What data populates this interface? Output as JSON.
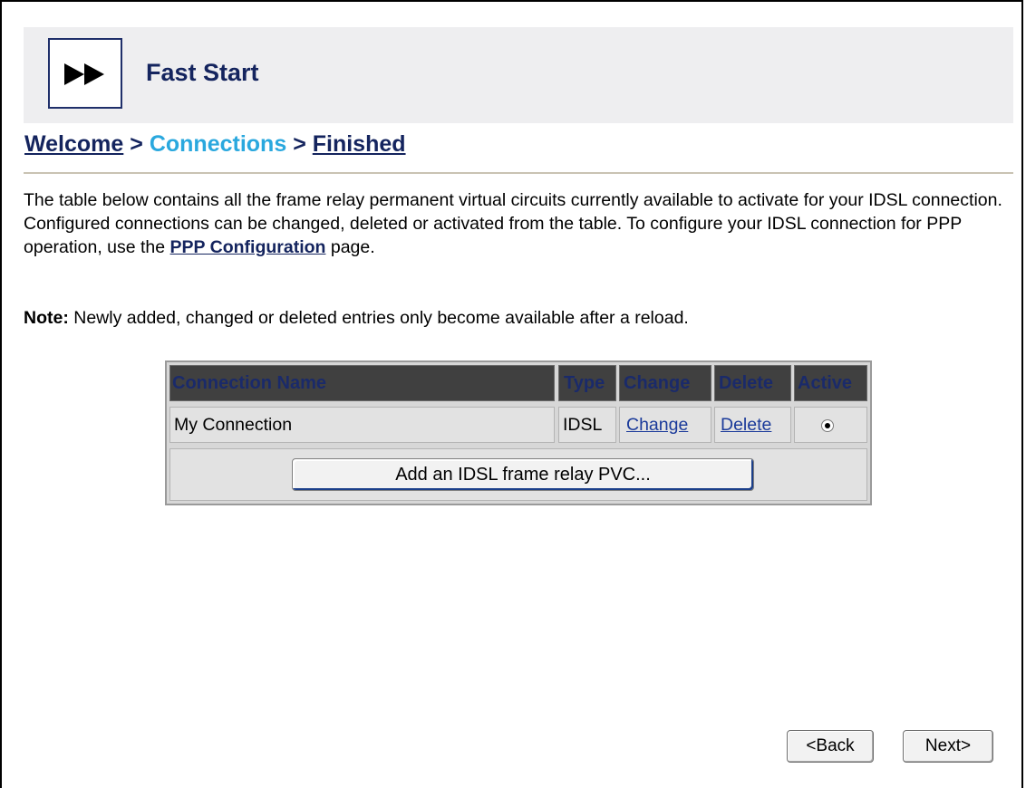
{
  "header": {
    "title": "Fast Start",
    "logo_icon": "fast-forward-icon"
  },
  "breadcrumb": {
    "items": [
      "Welcome",
      "Connections",
      "Finished"
    ],
    "separator": ">"
  },
  "intro": {
    "text_before_link": "The table below contains all the frame relay permanent virtual circuits currently available to activate for your IDSL connection. Configured connections can be changed, deleted or activated from the table. To configure your IDSL connection for PPP operation, use the ",
    "link_text": "PPP Configuration",
    "text_after_link": " page."
  },
  "note": {
    "label": "Note:",
    "text": " Newly added, changed or deleted entries only become available after a reload."
  },
  "connections_table": {
    "columns": [
      "Connection Name",
      "Type",
      "Change",
      "Delete",
      "Active"
    ],
    "rows": [
      {
        "name": "My Connection",
        "type": "IDSL",
        "change": "Change",
        "delete": "Delete",
        "active": true
      }
    ],
    "add_button_label": "Add an IDSL frame relay PVC..."
  },
  "navigation": {
    "back_label": "<Back",
    "next_label": "Next>"
  },
  "colors": {
    "brand_navy": "#14245e",
    "current_step": "#2aa8de",
    "table_header_bg": "#404040",
    "header_band_bg": "#eeeef0"
  }
}
